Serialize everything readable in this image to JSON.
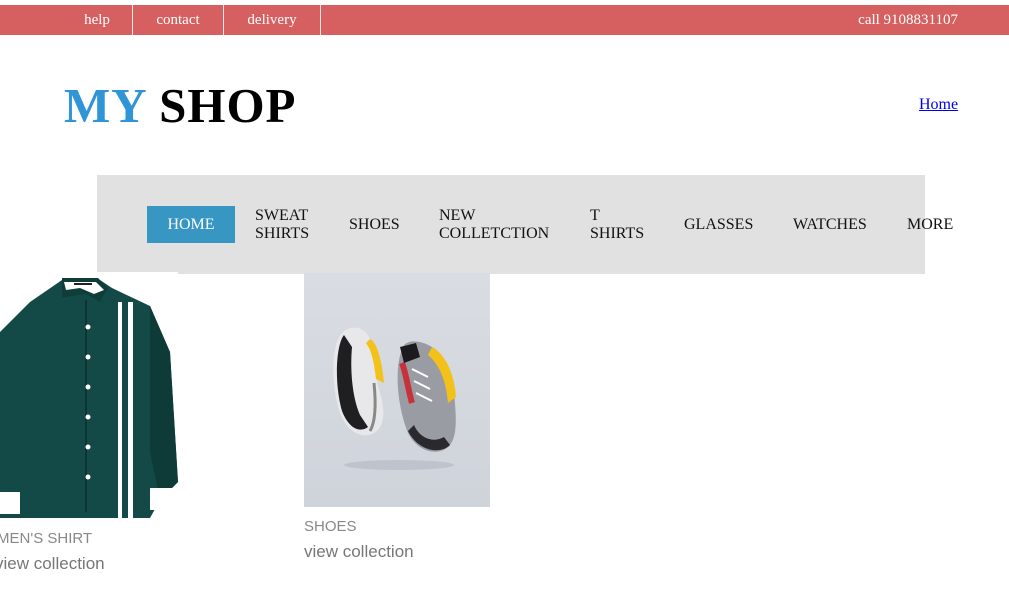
{
  "topbar": {
    "links": [
      "help",
      "contact",
      "delivery"
    ],
    "phone": "call 9108831107"
  },
  "logo": {
    "part1": "MY",
    "part2": "SHOP"
  },
  "home_link": "Home",
  "nav": {
    "items": [
      "HOME",
      "SWEAT SHIRTS",
      "SHOES",
      "NEW COLLETCTION",
      "T SHIRTS",
      "GLASSES",
      "WATCHES",
      "MORE"
    ]
  },
  "products": [
    {
      "title": "MEN'S SHIRT",
      "link": "view collection"
    },
    {
      "title": "SHOES",
      "link": "view collection"
    }
  ],
  "colors": {
    "topbar": "#d65f60",
    "logo_accent": "#2f95d6",
    "nav_bg": "#e1e1e1",
    "nav_active": "#3796c2"
  }
}
